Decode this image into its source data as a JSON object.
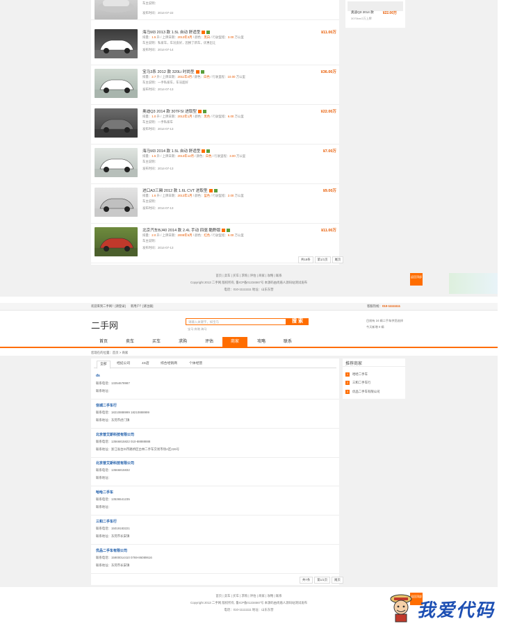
{
  "listings": [
    {
      "title": "",
      "price": "",
      "specs": "",
      "note": "车主说明：",
      "date": "发布时间：2014-07-22"
    },
    {
      "title": "海马M3 2013 款 1.5L 自动 舒适型",
      "price": "¥11.00万",
      "specs_prefix": "排量：",
      "disp": "1.5",
      "specs_mid1": " 升 / 上牌日期：",
      "reg": "2013年3月",
      "specs_mid2": " / 颜色：",
      "color": "黑白",
      "specs_mid3": " / 行驶里程：",
      "km": "3.00",
      "specs_end": " 万公里",
      "note": "车主说明：私家车，车况良好，因换了新车，优惠出让",
      "date": "发布时间：2014-07-14"
    },
    {
      "title": "宝马3系 2012 款 320Li 时尚型",
      "price": "¥36.00万",
      "specs_prefix": "排量：",
      "disp": "2.7",
      "specs_mid1": " 升 / 上牌日期：",
      "reg": "2011年4月",
      "specs_mid2": " / 颜色：",
      "color": "白色",
      "specs_mid3": " / 行驶里程：",
      "km": "10.00",
      "specs_end": " 万公里",
      "note": "车主说明：一手私家车，车况超好",
      "date": "发布时间：2014-07-13"
    },
    {
      "title": "奥迪Q3 2014 款 30TFSI 进取型",
      "price": "¥22.00万",
      "specs_prefix": "排量：",
      "disp": "1.0",
      "specs_mid1": " 升 / 上牌日期：",
      "reg": "2012年1月",
      "specs_mid2": " / 颜色：",
      "color": "黑色",
      "specs_mid3": " / 行驶里程：",
      "km": "6.00",
      "specs_end": " 万公里",
      "note": "车主说明：一手私家车",
      "date": "发布时间：2014-07-13"
    },
    {
      "title": "海马M3 2014 款 1.5L 自动 舒适型",
      "price": "¥7.00万",
      "specs_prefix": "排量：",
      "disp": "1.5",
      "specs_mid1": " 升 / 上牌日期：",
      "reg": "2013年12月",
      "specs_mid2": " / 颜色：",
      "color": "白色",
      "specs_mid3": " / 行驶里程：",
      "km": "3.00",
      "specs_end": " 万公里",
      "note": "车主说明：",
      "date": "发布时间：2014-07-13"
    },
    {
      "title": "进口A3三厢 2012 款 1.6L CVT 进取型",
      "price": "¥9.00万",
      "specs_prefix": "排量：",
      "disp": "1.6",
      "specs_mid1": " 升 / 上牌日期：",
      "reg": "2013年1月",
      "specs_mid2": " / 颜色：",
      "color": "蓝色",
      "specs_mid3": " / 行驶里程：",
      "km": "2.00",
      "specs_end": " 万公里",
      "note": "车主说明：",
      "date": "发布时间：2014-07-13"
    },
    {
      "title": "北京汽车BJ40 2014 款 2.4L 手动 四驱 酷野版",
      "price": "¥11.00万",
      "specs_prefix": "排量：",
      "disp": "2.0",
      "specs_mid1": " 升 / 上牌日期：",
      "reg": "2008年5月",
      "specs_mid2": " / 颜色：",
      "color": "红色",
      "specs_mid3": " / 行驶里程：",
      "km": "6.00",
      "specs_end": " 万公里",
      "note": "车主说明：",
      "date": "发布时间：2014-07-13"
    }
  ],
  "side_top": {
    "name": "奥迪Q3 2014 款",
    "price": "¥22.00万",
    "sub": "3070km/2万上牌"
  },
  "pager1": {
    "total": "共18条",
    "page": "第1/1页",
    "last": "尾页"
  },
  "footer": {
    "links": "首页 | 卖车 | 买车 | 求购 | 评估 | 商家 | 攻略 | 联系",
    "copy": "Copyright 2013 二手网 版权所有, 鲁ICP备01234567号 本源码由尚盾人源码站测试发布",
    "contact": "电话：010-11111111 地址：山东东营"
  },
  "backtop": "返回顶部",
  "topbar": {
    "welcome": "欢迎来到二手网！[请登录]",
    "newuser": "新用户？[请注册]",
    "hotline_label": "客服热线：",
    "hotline": "010-11111111"
  },
  "logo": "二手网",
  "search": {
    "placeholder": "请输入关键字，如宝马",
    "button": "搜 索",
    "hot": "宝马 奔驰 海马"
  },
  "header_right": {
    "stat1": "目前有 24 辆二手车供您选择",
    "stat2": "今天新增 0 辆"
  },
  "nav": [
    "首页",
    "卖车",
    "买车",
    "求购",
    "评估",
    "商家",
    "攻略",
    "联系"
  ],
  "crumb": "您现在的位置：首页 > 商家",
  "tabs": [
    "全部",
    "经纪公司",
    "4S店",
    "综合经销商",
    "个体经营"
  ],
  "dealers": [
    {
      "name": "ds",
      "phone": "联系电话：13254678987",
      "addr": "联系地址："
    },
    {
      "name": "信城二手车行",
      "phone": "联系电话：18210888999 18210888999",
      "addr": "联系地址：东莞市虎门镇"
    },
    {
      "name": "北京普艾斯科技有限公司",
      "phone": "联系电话：13566815822 010-88888888",
      "addr": "联系地址：浙江省台州市路桥区古林二手车交易市场A区226号"
    },
    {
      "name": "北京普艾斯科技有限公司",
      "phone": "联系电话：13566815832",
      "addr": "联系地址："
    },
    {
      "name": "哈哈二手车",
      "phone": "联系电话：13536541235",
      "addr": "联系地址："
    },
    {
      "name": "三和二手车行",
      "phone": "联系电话：15019183221",
      "addr": "联系地址：东莞市长安镇"
    },
    {
      "name": "优品二手车有限公司",
      "phone": "联系电话：15900014410 0769-86089616",
      "addr": "联系地址：东莞市长安镇"
    }
  ],
  "pager2": {
    "total": "共7条",
    "page": "第1/1页",
    "last": "尾页"
  },
  "recommend": {
    "title": "推荐商家",
    "items": [
      "哈哈二手车",
      "三和二手车行",
      "优品二手车有限公司"
    ]
  },
  "watermark": "我爱代码",
  "colors": {
    "accent": "#ff6d00",
    "price": "#e85a00",
    "link": "#1a5aa8"
  }
}
